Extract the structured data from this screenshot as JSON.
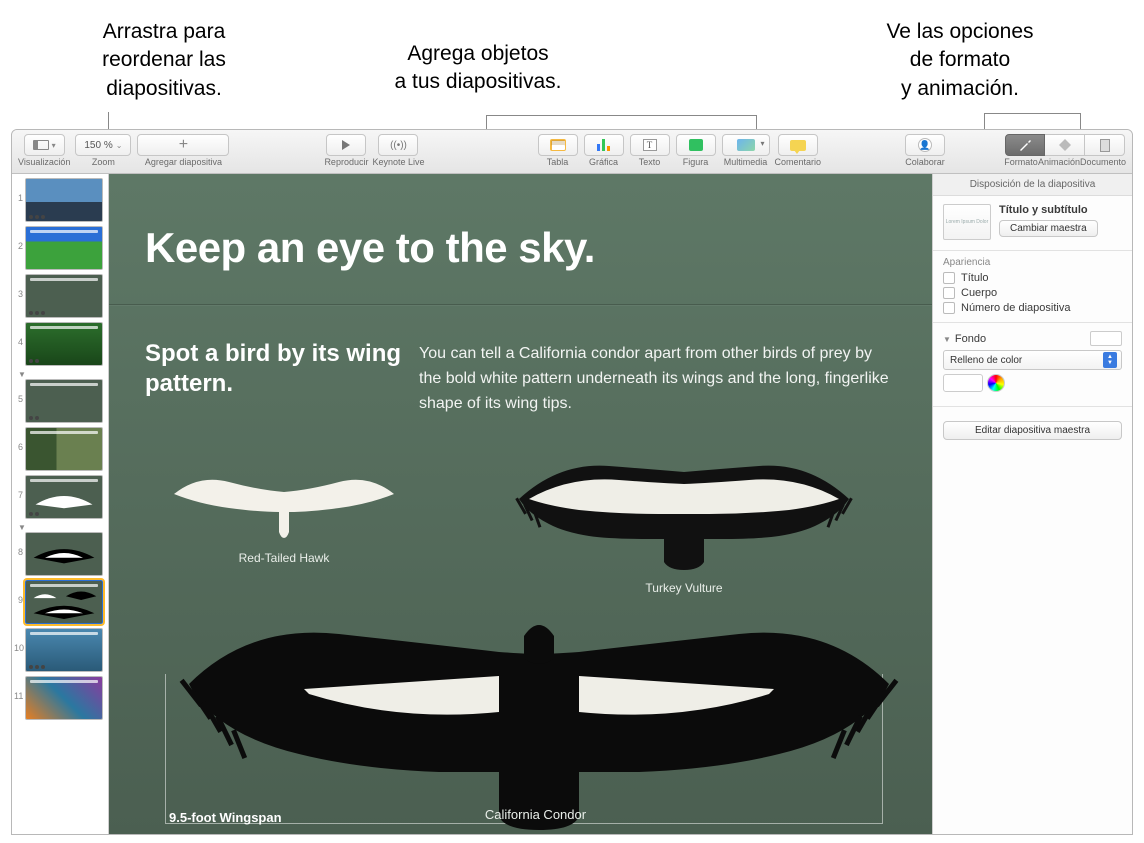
{
  "annotations": {
    "reorder": "Arrastra para\nreordenar las\ndiapositivas.",
    "add_objects": "Agrega objetos\na tus diapositivas.",
    "format_anim": "Ve las opciones\nde formato\ny animación."
  },
  "toolbar": {
    "view_label": "Visualización",
    "zoom_value": "150 %",
    "zoom_label": "Zoom",
    "add_slide": "Agregar diapositiva",
    "play": "Reproducir",
    "keynote_live": "Keynote Live",
    "table": "Tabla",
    "chart": "Gráfica",
    "text": "Texto",
    "shape": "Figura",
    "media": "Multimedia",
    "comment": "Comentario",
    "collaborate": "Colaborar",
    "format": "Formato",
    "animate": "Animación",
    "document": "Documento"
  },
  "navigator": {
    "slide_numbers": [
      "1",
      "2",
      "3",
      "4",
      "5",
      "6",
      "7",
      "8",
      "9",
      "10",
      "11"
    ],
    "selected_index": 8
  },
  "slide": {
    "title": "Keep an eye to the sky.",
    "subheader": "Spot a bird by its wing pattern.",
    "body": "You can tell a California condor apart from other birds of prey by the bold white pattern underneath its wings and the long, fingerlike shape of its wing tips.",
    "hawk_label": "Red-Tailed Hawk",
    "vulture_label": "Turkey Vulture",
    "condor_label": "California Condor",
    "wingspan": "9.5-foot Wingspan"
  },
  "inspector": {
    "header": "Disposición de la diapositiva",
    "layout_name": "Título y subtítulo",
    "change_master": "Cambiar maestra",
    "appearance": "Apariencia",
    "cb_title": "Título",
    "cb_body": "Cuerpo",
    "cb_slidenum": "Número de diapositiva",
    "background": "Fondo",
    "fill_type": "Relleno de color",
    "edit_master": "Editar diapositiva maestra"
  }
}
